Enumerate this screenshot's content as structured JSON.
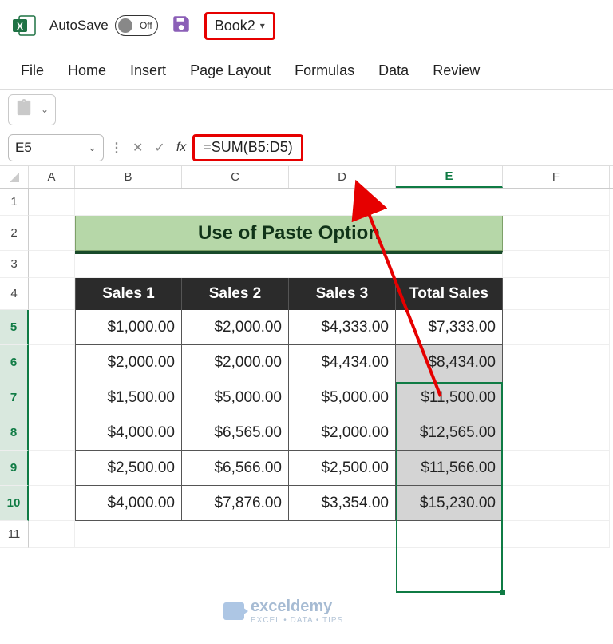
{
  "titlebar": {
    "autosave_label": "AutoSave",
    "toggle_off": "Off",
    "book_name": "Book2"
  },
  "menu": {
    "file": "File",
    "home": "Home",
    "insert": "Insert",
    "page_layout": "Page Layout",
    "formulas": "Formulas",
    "data": "Data",
    "review": "Review"
  },
  "namebox": "E5",
  "fx_label": "fx",
  "formula": "=SUM(B5:D5)",
  "columns": [
    "A",
    "B",
    "C",
    "D",
    "E",
    "F"
  ],
  "rows": [
    "1",
    "2",
    "3",
    "4",
    "5",
    "6",
    "7",
    "8",
    "9",
    "10",
    "11"
  ],
  "sheet_title": "Use of Paste Option",
  "table": {
    "headers": [
      "Sales 1",
      "Sales 2",
      "Sales 3",
      "Total Sales"
    ],
    "data": [
      [
        "$1,000.00",
        "$2,000.00",
        "$4,333.00",
        "$7,333.00"
      ],
      [
        "$2,000.00",
        "$2,000.00",
        "$4,434.00",
        "$8,434.00"
      ],
      [
        "$1,500.00",
        "$5,000.00",
        "$5,000.00",
        "$11,500.00"
      ],
      [
        "$4,000.00",
        "$6,565.00",
        "$2,000.00",
        "$12,565.00"
      ],
      [
        "$2,500.00",
        "$6,566.00",
        "$2,500.00",
        "$11,566.00"
      ],
      [
        "$4,000.00",
        "$7,876.00",
        "$3,354.00",
        "$15,230.00"
      ]
    ]
  },
  "watermark": {
    "brand": "exceldemy",
    "tagline": "EXCEL • DATA • TIPS"
  }
}
